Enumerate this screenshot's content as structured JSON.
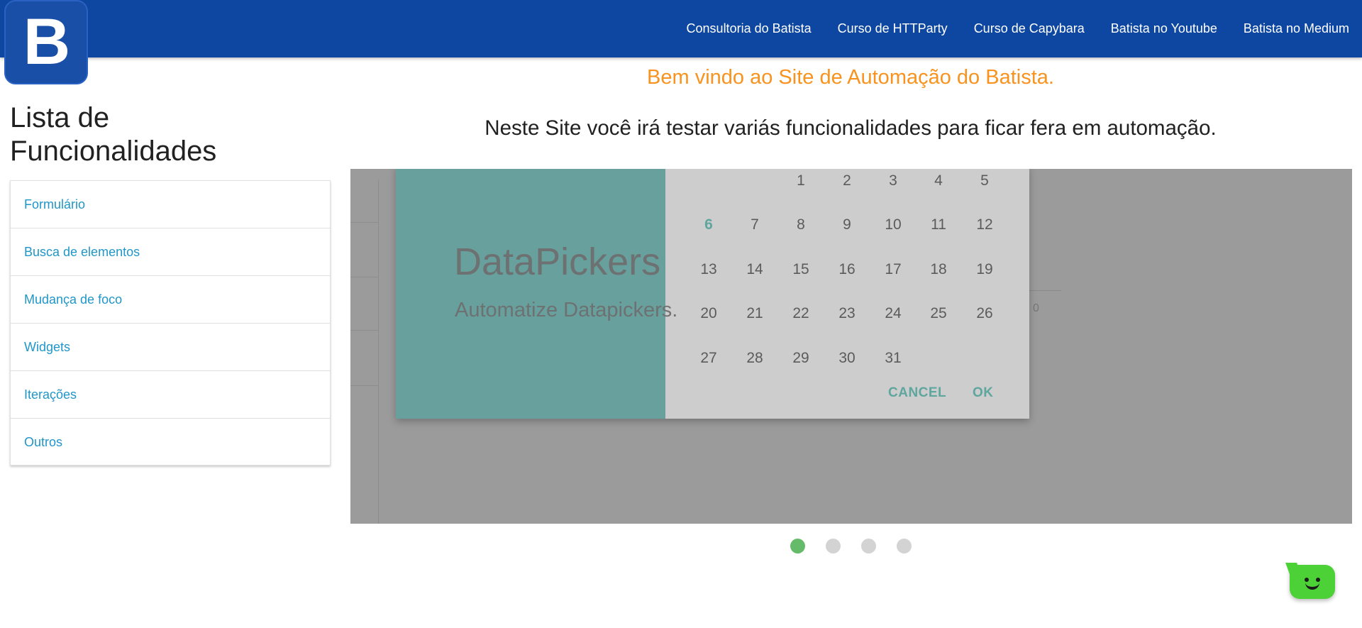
{
  "logo": {
    "letter": "B"
  },
  "nav": {
    "links": [
      "Consultoria do Batista",
      "Curso de HTTParty",
      "Curso de Capybara",
      "Batista no Youtube",
      "Batista no Medium"
    ]
  },
  "welcome": "Bem vindo ao Site de Automação do Batista.",
  "subtitle": "Neste Site você irá testar variás funcionalidades para ficar fera em automação.",
  "sidebar": {
    "title": "Lista de Funcionalidades",
    "items": [
      "Formulário",
      "Busca de elementos",
      "Mudança de foco",
      "Widgets",
      "Iterações",
      "Outros"
    ]
  },
  "slider": {
    "caption_title": "DataPickers",
    "caption_subtitle": "Automatize Datapickers.",
    "calendar": {
      "days": [
        "1",
        "2",
        "3",
        "4",
        "5",
        "6",
        "7",
        "8",
        "9",
        "10",
        "11",
        "12",
        "13",
        "14",
        "15",
        "16",
        "17",
        "18",
        "19",
        "20",
        "21",
        "22",
        "23",
        "24",
        "25",
        "26",
        "27",
        "28",
        "29",
        "30",
        "31"
      ],
      "selected_day": "6",
      "cancel_label": "CANCEL",
      "ok_label": "OK"
    },
    "background_axis_label": "0",
    "dots": {
      "count": 4,
      "active_index": 0
    }
  },
  "colors": {
    "navbar": "#0d47a1",
    "welcome": "#f7931e",
    "link": "#2196c8",
    "picker_header": "#67a09c",
    "picker_accent": "#5ea69e",
    "dot_active": "#66bb6a",
    "chat": "#4cd137"
  },
  "chat": {
    "icon": "chat-bot-icon"
  }
}
